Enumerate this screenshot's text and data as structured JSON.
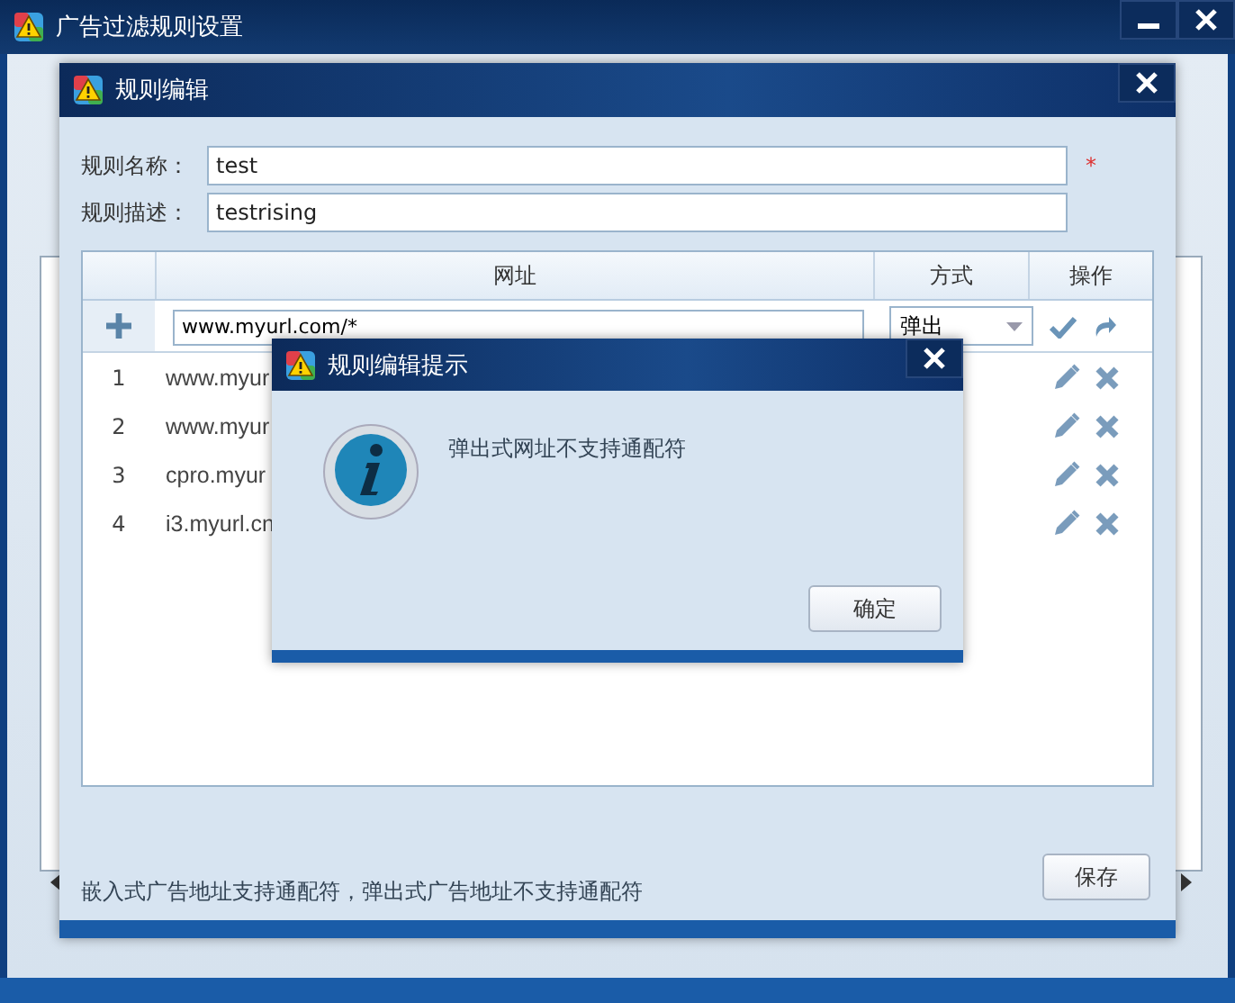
{
  "window": {
    "title": "广告过滤规则设置"
  },
  "dialog": {
    "title": "规则编辑",
    "fields": [
      {
        "label": "规则名称：",
        "value": "test",
        "required_mark": "*"
      },
      {
        "label": "规则描述：",
        "value": "testrising"
      }
    ],
    "table": {
      "columns": [
        "网址",
        "方式",
        "操作"
      ],
      "new_row": {
        "value": "www.myurl.com/*",
        "mode": "弹出"
      },
      "rows": [
        {
          "number": "1",
          "url": "www.myur"
        },
        {
          "number": "2",
          "url": "www.myur"
        },
        {
          "number": "3",
          "url": "cpro.myur"
        },
        {
          "number": "4",
          "url": "i3.myurl.cn"
        }
      ]
    },
    "note": "嵌入式广告地址支持通配符，弹出式广告地址不支持通配符",
    "save_button": "保存"
  },
  "message_box": {
    "title": "规则编辑提示",
    "message": "弹出式网址不支持通配符",
    "ok_button": "确定"
  }
}
